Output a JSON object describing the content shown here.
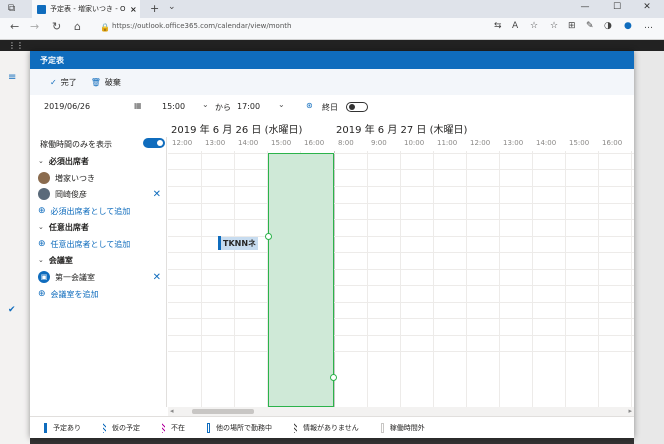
{
  "browser": {
    "tab_title": "予定表 - 増家いつき - Ou",
    "url": "https://outlook.office365.com/calendar/view/month"
  },
  "dialog": {
    "title": "予定表",
    "done_label": "完了",
    "discard_label": "破棄",
    "date": "2019/06/26",
    "start_time": "15:00",
    "from_label": "から",
    "end_time": "17:00",
    "allday_label": "終日",
    "working_hours_label": "稼働時間のみを表示"
  },
  "attendees": {
    "required_header": "必須出席者",
    "people": [
      "増家いつき",
      "岡崎俊彦"
    ],
    "add_required": "必須出席者として追加",
    "optional_header": "任意出席者",
    "add_optional": "任意出席者として追加",
    "room_header": "会議室",
    "room": "第一会議室",
    "add_room": "会議室を追加"
  },
  "grid": {
    "day1": "2019 年 6 月 26 日 (水曜日)",
    "day2": "2019 年 6 月 27 日 (木曜日)",
    "hours1": [
      "12:00",
      "13:00",
      "14:00",
      "15:00",
      "16:00"
    ],
    "hours2": [
      "8:00",
      "9:00",
      "10:00",
      "11:00",
      "12:00",
      "13:00",
      "14:00",
      "15:00",
      "16:00"
    ],
    "busy_label": "TKNNネ"
  },
  "legend": [
    "予定あり",
    "仮の予定",
    "不在",
    "他の場所で勤務中",
    "情報がありません",
    "稼働時間外"
  ],
  "colors": {
    "accent": "#0f6cbd",
    "selection": "#cfe9d7",
    "selection_border": "#2bb34a"
  }
}
